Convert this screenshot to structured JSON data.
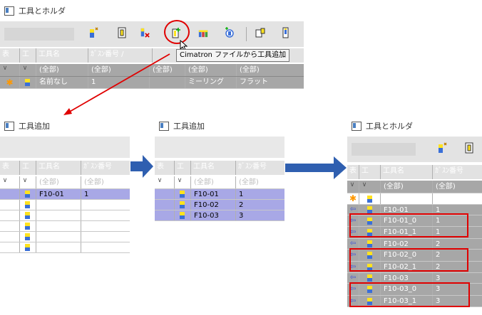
{
  "top_window": {
    "title": "工具とホルダ",
    "tooltip": "Cimatron ファイルから工具追加",
    "columns": [
      "表",
      "工",
      "工具名",
      "ｶﾞｽﾝ番号 /"
    ],
    "filters": [
      "(全部)",
      "(全部)",
      "(全部)",
      "(全部)",
      "(全部)"
    ],
    "row": {
      "name": "名前なし",
      "num": "1",
      "type": "ミーリング",
      "shape": "フラット"
    }
  },
  "add_window_1": {
    "title": "工具追加",
    "columns": [
      "表",
      "工",
      "工具名",
      "ｶﾞｽﾝ番号"
    ],
    "filters": [
      "(全部)",
      "(全部)"
    ],
    "rows": [
      {
        "name": "F10-01",
        "num": "1"
      }
    ]
  },
  "add_window_2": {
    "title": "工具追加",
    "columns": [
      "表",
      "工",
      "工具名",
      "ｶﾞｽﾝ番号"
    ],
    "filters": [
      "(全部)",
      "(全部)"
    ],
    "rows": [
      {
        "name": "F10-01",
        "num": "1"
      },
      {
        "name": "F10-02",
        "num": "2"
      },
      {
        "name": "F10-03",
        "num": "3"
      }
    ]
  },
  "result_window": {
    "title": "工具とホルダ",
    "columns": [
      "表",
      "工",
      "工具名",
      "ｶﾞｽﾝ番号"
    ],
    "filters": [
      "(全部)",
      "(全部)"
    ],
    "rows": [
      {
        "name": "F10-01",
        "num": "1"
      },
      {
        "name": "F10-01_0",
        "num": "1"
      },
      {
        "name": "F10-01_1",
        "num": "1"
      },
      {
        "name": "F10-02",
        "num": "2"
      },
      {
        "name": "F10-02_0",
        "num": "2"
      },
      {
        "name": "F10-02_1",
        "num": "2"
      },
      {
        "name": "F10-03",
        "num": "3"
      },
      {
        "name": "F10-03_0",
        "num": "3"
      },
      {
        "name": "F10-03_1",
        "num": "3"
      }
    ]
  },
  "colors": {
    "highlight": "#e00000",
    "selected_row": "#a8a8e6",
    "arrow_blue": "#2f5fb0"
  }
}
